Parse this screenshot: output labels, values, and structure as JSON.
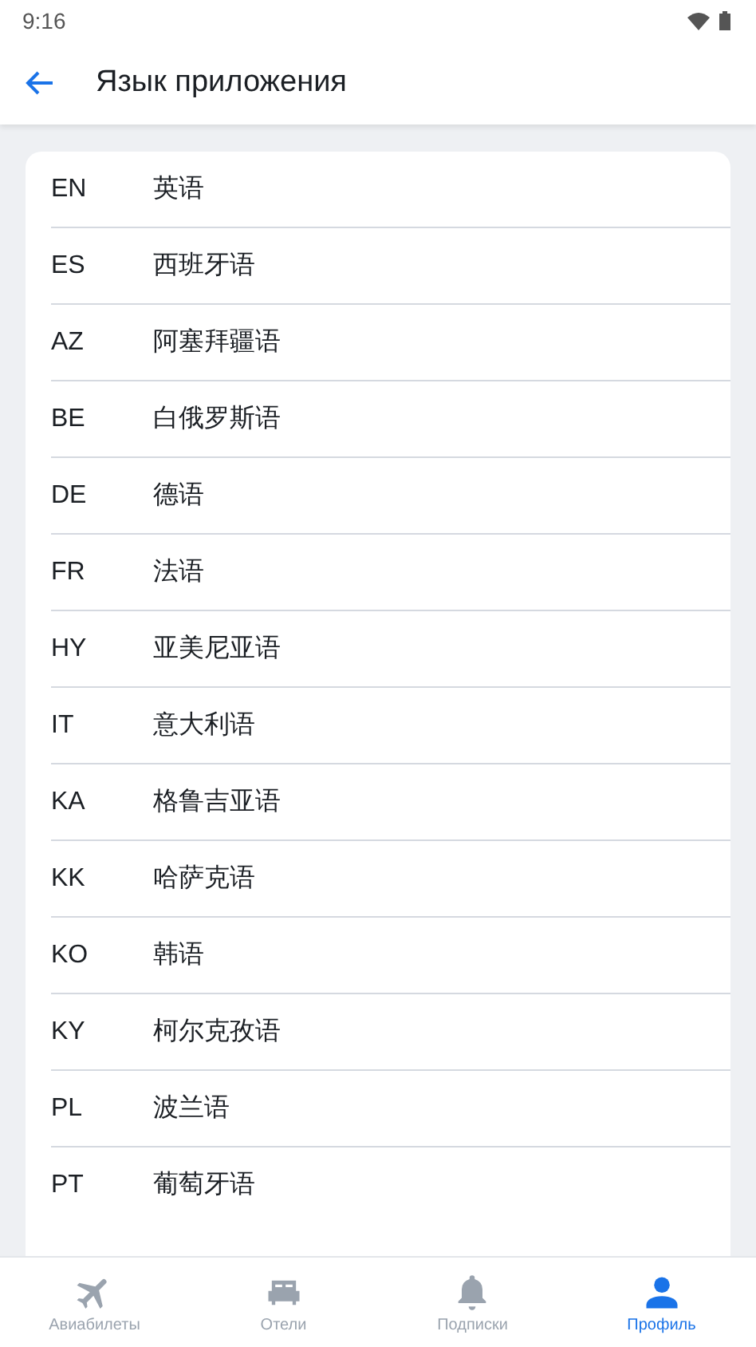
{
  "status_bar": {
    "time": "9:16"
  },
  "header": {
    "title": "Язык приложения"
  },
  "languages": [
    {
      "code": "EN",
      "name": "英语"
    },
    {
      "code": "ES",
      "name": "西班牙语"
    },
    {
      "code": "AZ",
      "name": "阿塞拜疆语"
    },
    {
      "code": "BE",
      "name": "白俄罗斯语"
    },
    {
      "code": "DE",
      "name": "德语"
    },
    {
      "code": "FR",
      "name": "法语"
    },
    {
      "code": "HY",
      "name": "亚美尼亚语"
    },
    {
      "code": "IT",
      "name": "意大利语"
    },
    {
      "code": "KA",
      "name": "格鲁吉亚语"
    },
    {
      "code": "KK",
      "name": "哈萨克语"
    },
    {
      "code": "KO",
      "name": "韩语"
    },
    {
      "code": "KY",
      "name": "柯尔克孜语"
    },
    {
      "code": "PL",
      "name": "波兰语"
    },
    {
      "code": "PT",
      "name": "葡萄牙语"
    }
  ],
  "bottom_nav": [
    {
      "kind": "plane",
      "label": "Авиабилеты",
      "selected": false
    },
    {
      "kind": "bed",
      "label": "Отели",
      "selected": false
    },
    {
      "kind": "bell",
      "label": "Подписки",
      "selected": false
    },
    {
      "kind": "person",
      "label": "Профиль",
      "selected": true
    }
  ]
}
